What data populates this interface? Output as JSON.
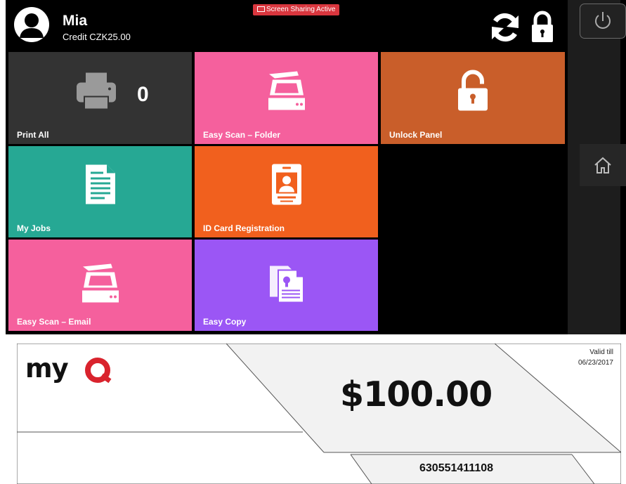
{
  "user": {
    "name": "Mia",
    "credit": "Credit CZK25.00"
  },
  "banner": {
    "screen_sharing": "Screen Sharing Active"
  },
  "header": {
    "refresh_icon": "refresh-icon",
    "lock_icon": "lock-icon"
  },
  "tiles": [
    {
      "label": "Print All",
      "icon": "printer-icon",
      "count": "0",
      "color": "#333333"
    },
    {
      "label": "Easy Scan – Folder",
      "icon": "scanner-icon",
      "color": "#f5609d"
    },
    {
      "label": "Unlock Panel",
      "icon": "unlock-icon",
      "color": "#c95e2a"
    },
    {
      "label": "My Jobs",
      "icon": "document-icon",
      "color": "#26a894"
    },
    {
      "label": "ID Card Registration",
      "icon": "id-card-icon",
      "color": "#f1601e"
    },
    {
      "label": "Easy Scan – Email",
      "icon": "scanner-icon",
      "color": "#f5609d"
    },
    {
      "label": "Easy Copy",
      "icon": "copy-icon",
      "color": "#9b56f5"
    }
  ],
  "side": {
    "power_icon": "power-icon",
    "home_icon": "home-icon"
  },
  "voucher": {
    "logo": "myQ",
    "amount": "$100.00",
    "valid_label": "Valid till",
    "valid_date": "06/23/2017",
    "code": "630551411108"
  }
}
